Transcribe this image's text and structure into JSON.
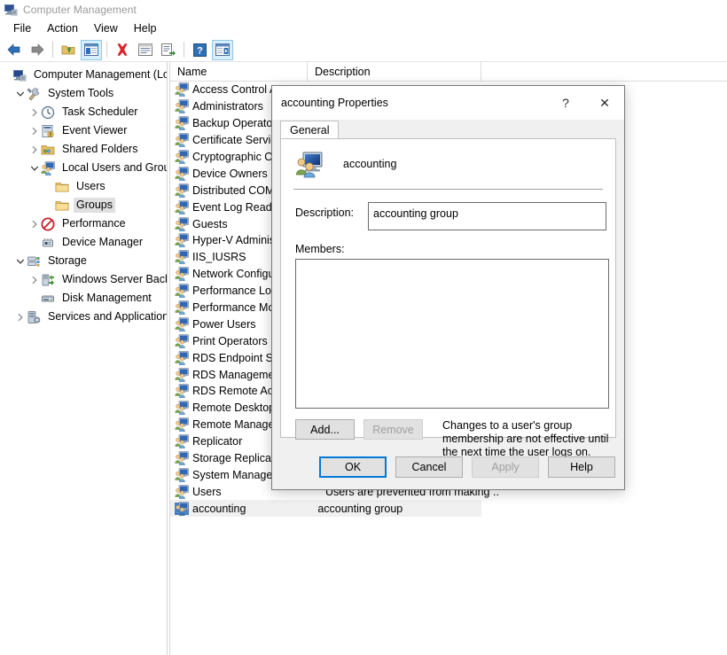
{
  "window": {
    "title": "Computer Management",
    "icon": "computer-management-icon"
  },
  "menu": {
    "items": [
      {
        "label": "File"
      },
      {
        "label": "Action"
      },
      {
        "label": "View"
      },
      {
        "label": "Help"
      }
    ]
  },
  "toolbar": {
    "buttons": [
      {
        "name": "back-icon",
        "glyph": "back-arrow"
      },
      {
        "name": "forward-icon",
        "glyph": "forward-arrow"
      },
      {
        "name": "up-folder-icon",
        "glyph": "up-folder"
      },
      {
        "name": "show-hide-console-tree-icon",
        "glyph": "console-tree",
        "selected": true
      },
      {
        "name": "delete-icon",
        "glyph": "red-x"
      },
      {
        "name": "properties-icon",
        "glyph": "properties"
      },
      {
        "name": "export-list-icon",
        "glyph": "export-list"
      },
      {
        "name": "help-icon",
        "glyph": "help-question"
      },
      {
        "name": "show-hide-action-pane-icon",
        "glyph": "action-pane",
        "selected": true
      }
    ]
  },
  "tree": {
    "items": [
      {
        "label": "Computer Management (Local",
        "depth": 0,
        "twisty": "none",
        "icon": "computer-icon",
        "selected": false
      },
      {
        "label": "System Tools",
        "depth": 1,
        "twisty": "expanded",
        "icon": "system-tools-icon",
        "selected": false
      },
      {
        "label": "Task Scheduler",
        "depth": 2,
        "twisty": "collapsed",
        "icon": "task-scheduler-icon",
        "selected": false
      },
      {
        "label": "Event Viewer",
        "depth": 2,
        "twisty": "collapsed",
        "icon": "event-viewer-icon",
        "selected": false
      },
      {
        "label": "Shared Folders",
        "depth": 2,
        "twisty": "collapsed",
        "icon": "shared-folders-icon",
        "selected": false
      },
      {
        "label": "Local Users and Groups",
        "depth": 2,
        "twisty": "expanded",
        "icon": "local-users-groups-icon",
        "selected": false
      },
      {
        "label": "Users",
        "depth": 3,
        "twisty": "none",
        "icon": "folder-icon",
        "selected": false
      },
      {
        "label": "Groups",
        "depth": 3,
        "twisty": "none",
        "icon": "folder-icon",
        "selected": true
      },
      {
        "label": "Performance",
        "depth": 2,
        "twisty": "collapsed",
        "icon": "performance-icon",
        "selected": false
      },
      {
        "label": "Device Manager",
        "depth": 2,
        "twisty": "none",
        "icon": "device-manager-icon",
        "selected": false
      },
      {
        "label": "Storage",
        "depth": 1,
        "twisty": "expanded",
        "icon": "storage-icon",
        "selected": false
      },
      {
        "label": "Windows Server Backup",
        "depth": 2,
        "twisty": "collapsed",
        "icon": "server-backup-icon",
        "selected": false
      },
      {
        "label": "Disk Management",
        "depth": 2,
        "twisty": "none",
        "icon": "disk-management-icon",
        "selected": false
      },
      {
        "label": "Services and Applications",
        "depth": 1,
        "twisty": "collapsed",
        "icon": "services-apps-icon",
        "selected": false
      }
    ]
  },
  "list": {
    "columns": [
      {
        "label": "Name"
      },
      {
        "label": "Description"
      }
    ],
    "rows": [
      {
        "name": "Access Control A",
        "desc": "",
        "icon": "group-icon",
        "selected": false
      },
      {
        "name": "Administrators",
        "desc": "",
        "icon": "group-icon",
        "selected": false
      },
      {
        "name": "Backup Operators",
        "desc": "",
        "icon": "group-icon",
        "selected": false
      },
      {
        "name": "Certificate Service",
        "desc": "",
        "icon": "group-icon",
        "selected": false
      },
      {
        "name": "Cryptographic Op",
        "desc": "",
        "icon": "group-icon",
        "selected": false
      },
      {
        "name": "Device Owners",
        "desc": "",
        "icon": "group-icon",
        "selected": false
      },
      {
        "name": "Distributed COM",
        "desc": "",
        "icon": "group-icon",
        "selected": false
      },
      {
        "name": "Event Log Reader",
        "desc": "",
        "icon": "group-icon",
        "selected": false
      },
      {
        "name": "Guests",
        "desc": "",
        "icon": "group-icon",
        "selected": false
      },
      {
        "name": "Hyper-V Adminis",
        "desc": "",
        "icon": "group-icon",
        "selected": false
      },
      {
        "name": "IIS_IUSRS",
        "desc": "",
        "icon": "group-icon",
        "selected": false
      },
      {
        "name": "Network Configu",
        "desc": "",
        "icon": "group-icon",
        "selected": false
      },
      {
        "name": "Performance Log",
        "desc": "",
        "icon": "group-icon",
        "selected": false
      },
      {
        "name": "Performance Mor",
        "desc": "",
        "icon": "group-icon",
        "selected": false
      },
      {
        "name": "Power Users",
        "desc": "",
        "icon": "group-icon",
        "selected": false
      },
      {
        "name": "Print Operators",
        "desc": "",
        "icon": "group-icon",
        "selected": false
      },
      {
        "name": "RDS Endpoint Ser",
        "desc": "",
        "icon": "group-icon",
        "selected": false
      },
      {
        "name": "RDS Managemen",
        "desc": "",
        "icon": "group-icon",
        "selected": false
      },
      {
        "name": "RDS Remote Acce",
        "desc": "",
        "icon": "group-icon",
        "selected": false
      },
      {
        "name": "Remote Desktop",
        "desc": "",
        "icon": "group-icon",
        "selected": false
      },
      {
        "name": "Remote Manager",
        "desc": "",
        "icon": "group-icon",
        "selected": false
      },
      {
        "name": "Replicator",
        "desc": "",
        "icon": "group-icon",
        "selected": false
      },
      {
        "name": "Storage Replica A",
        "desc": "",
        "icon": "group-icon",
        "selected": false
      },
      {
        "name": "System Managed",
        "desc": "",
        "icon": "group-icon",
        "selected": false
      },
      {
        "name": "Users",
        "desc": "Users are prevented from making ...",
        "icon": "group-icon",
        "selected": false
      },
      {
        "name": "accounting",
        "desc": "accounting group",
        "icon": "group-icon-selected",
        "selected": true
      }
    ]
  },
  "dialog": {
    "title": "accounting Properties",
    "help_glyph": "?",
    "close_glyph": "✕",
    "tabs": [
      {
        "label": "General",
        "active": true
      }
    ],
    "group_icon": "group-properties-icon",
    "group_name": "accounting",
    "description_label": "Description:",
    "description_value": "accounting group",
    "members_label": "Members:",
    "members": [],
    "add_label": "Add...",
    "remove_label": "Remove",
    "remove_disabled": true,
    "hint": "Changes to a user's group membership are not effective until the next time the user logs on.",
    "footer": [
      {
        "label": "OK",
        "default": true,
        "disabled": false
      },
      {
        "label": "Cancel",
        "default": false,
        "disabled": false
      },
      {
        "label": "Apply",
        "default": false,
        "disabled": true
      },
      {
        "label": "Help",
        "default": false,
        "disabled": false
      }
    ]
  },
  "colors": {
    "accent": "#0078d7",
    "dialog_face": "#f0f0f0",
    "selection": "#e0e0e0",
    "row_selection": "#f0f0f0",
    "title_text": "#9a9a9a"
  }
}
